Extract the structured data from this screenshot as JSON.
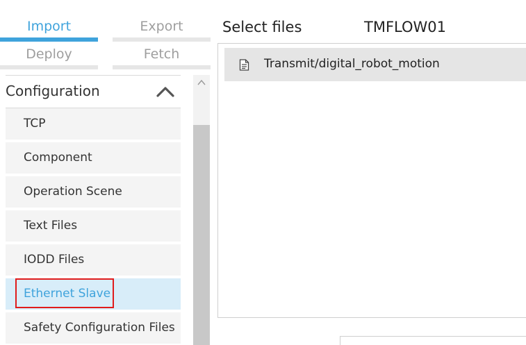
{
  "tabs": {
    "import": "Import",
    "export": "Export",
    "deploy": "Deploy",
    "fetch": "Fetch"
  },
  "sidebar": {
    "section_title": "Configuration",
    "items": [
      {
        "label": "TCP"
      },
      {
        "label": "Component"
      },
      {
        "label": "Operation Scene"
      },
      {
        "label": "Text Files"
      },
      {
        "label": "IODD Files"
      },
      {
        "label": "Ethernet Slave"
      },
      {
        "label": "Safety Configuration Files"
      }
    ],
    "selected_item": "Ethernet Slave"
  },
  "main": {
    "title": "Select files",
    "device": "TMFLOW01",
    "files": [
      {
        "name": "Transmit/digital_robot_motion",
        "icon": "document-icon"
      }
    ]
  },
  "colors": {
    "accent": "#3fa3dc",
    "selected_bg": "#d8edf9",
    "highlight": "#e01b1b"
  }
}
